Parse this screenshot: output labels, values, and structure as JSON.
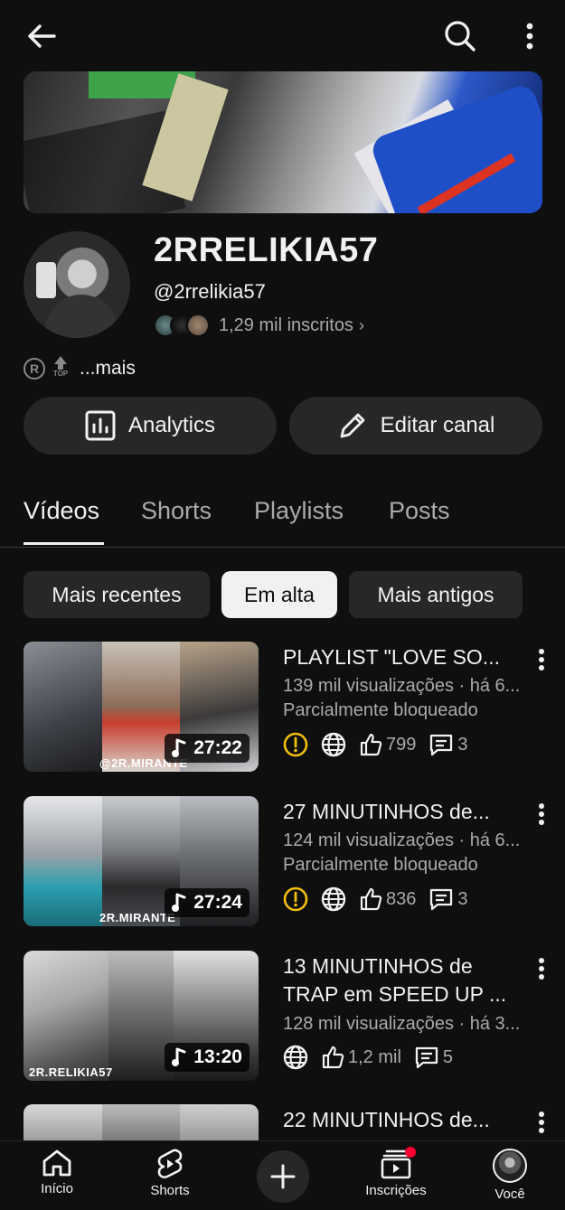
{
  "colors": {
    "background": "#0f0f0f",
    "surface": "#272727",
    "text": "#f1f1f1",
    "secondary": "#aaaaaa",
    "warning": "#f2c00c",
    "notification": "#ff0033"
  },
  "topbar": {
    "back_icon": "arrow-left-icon",
    "search_icon": "search-icon",
    "more_icon": "more-vertical-icon"
  },
  "channel": {
    "name": "2RRELIKIA57",
    "handle": "@2rrelikia57",
    "subscribers": "1,29 mil inscritos",
    "subscribers_chevron": "›",
    "badge_r": "R",
    "badge_top": "TOP",
    "more_link": "...mais"
  },
  "actions": {
    "analytics_label": "Analytics",
    "edit_label": "Editar canal"
  },
  "tabs": [
    {
      "label": "Vídeos",
      "active": true
    },
    {
      "label": "Shorts",
      "active": false
    },
    {
      "label": "Playlists",
      "active": false
    },
    {
      "label": "Posts",
      "active": false
    }
  ],
  "chips": [
    {
      "label": "Mais recentes",
      "active": false
    },
    {
      "label": "Em alta",
      "active": true
    },
    {
      "label": "Mais antigos",
      "active": false
    }
  ],
  "videos": [
    {
      "title": "PLAYLIST \"LOVE SO...",
      "duration": "27:22",
      "watermark": "@2R.MIRANTE",
      "meta": "139 mil visualizações · há 6...",
      "status": "Parcialmente bloqueado",
      "likes": "799",
      "comments": "3"
    },
    {
      "title": "27 MINUTINHOS de...",
      "duration": "27:24",
      "watermark": "2R.MIRANTE",
      "meta": "124 mil visualizações · há 6...",
      "status": "Parcialmente bloqueado",
      "likes": "836",
      "comments": "3"
    },
    {
      "title": "13 MINUTINHOS de TRAP em SPEED UP ...",
      "duration": "13:20",
      "watermark": "2R.RELIKIA57",
      "meta": "128 mil visualizações · há 3...",
      "likes": "1,2 mil",
      "comments": "5"
    },
    {
      "title": "22 MINUTINHOS de..."
    }
  ],
  "bottom_nav": [
    {
      "label": "Início",
      "icon": "home-icon"
    },
    {
      "label": "Shorts",
      "icon": "shorts-icon"
    },
    {
      "label": "",
      "icon": "plus-icon"
    },
    {
      "label": "Inscrições",
      "icon": "subscriptions-icon"
    },
    {
      "label": "Você",
      "icon": "avatar-icon"
    }
  ]
}
